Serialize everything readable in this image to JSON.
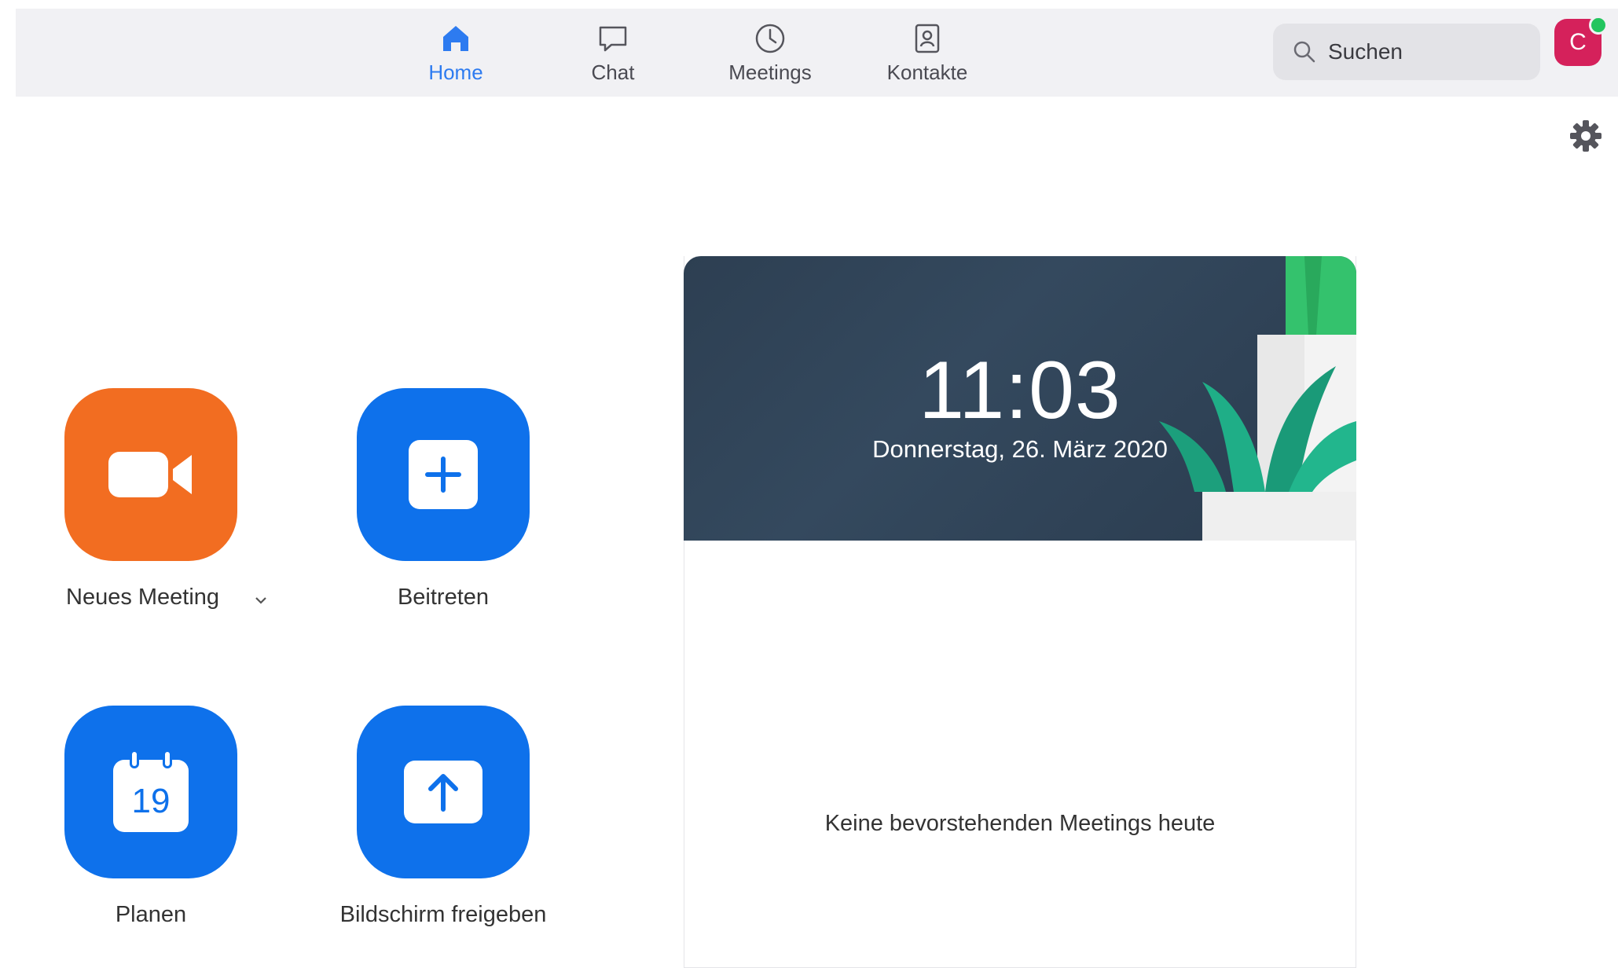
{
  "nav": {
    "items": [
      {
        "label": "Home",
        "icon": "home-icon",
        "active": true
      },
      {
        "label": "Chat",
        "icon": "chat-icon",
        "active": false
      },
      {
        "label": "Meetings",
        "icon": "clock-icon",
        "active": false
      },
      {
        "label": "Kontakte",
        "icon": "contacts-icon",
        "active": false
      }
    ]
  },
  "search": {
    "placeholder": "Suchen"
  },
  "user": {
    "avatar_initial": "C",
    "status": "online"
  },
  "actions": {
    "new_meeting": "Neues Meeting",
    "join": "Beitreten",
    "schedule": "Planen",
    "schedule_day": "19",
    "share_screen": "Bildschirm freigeben"
  },
  "calendar_card": {
    "time": "11:03",
    "date": "Donnerstag, 26. März 2020",
    "empty_message": "Keine bevorstehenden Meetings heute"
  },
  "colors": {
    "accent": "#0e71eb",
    "new_meeting": "#f26d21",
    "active_nav": "#2d7bf0",
    "avatar": "#d5215b"
  }
}
